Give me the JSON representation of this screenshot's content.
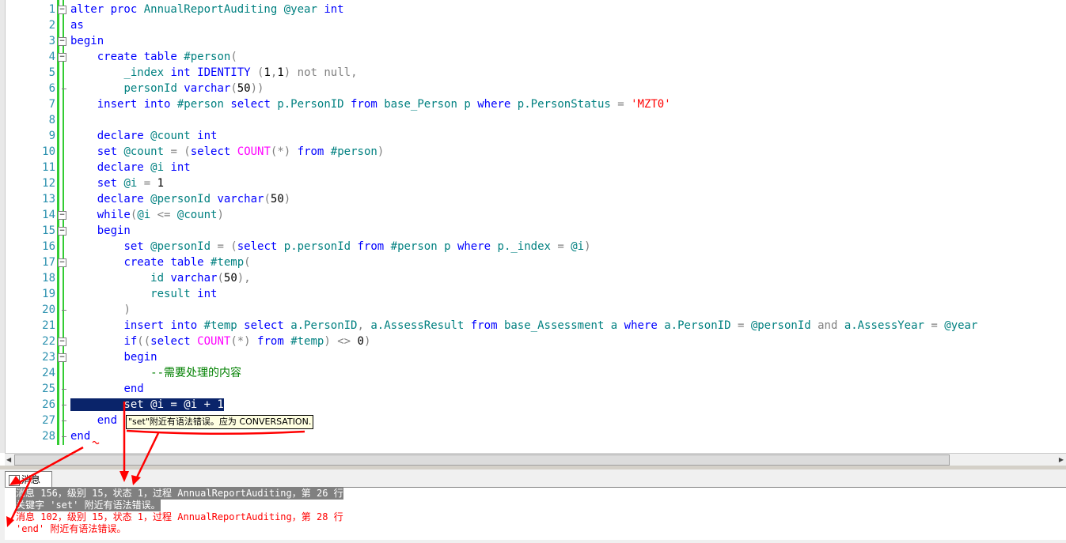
{
  "editor": {
    "lines": [
      {
        "n": "1",
        "tokens": [
          [
            "k",
            "alter proc "
          ],
          [
            "t",
            "AnnualReportAuditing "
          ],
          [
            "t",
            "@year "
          ],
          [
            "k",
            "int"
          ]
        ]
      },
      {
        "n": "2",
        "tokens": [
          [
            "k",
            "as"
          ]
        ]
      },
      {
        "n": "3",
        "tokens": [
          [
            "k",
            "begin"
          ]
        ]
      },
      {
        "n": "4",
        "tokens": [
          [
            "",
            "    "
          ],
          [
            "k",
            "create table "
          ],
          [
            "t",
            "#person"
          ],
          [
            "g",
            "("
          ]
        ]
      },
      {
        "n": "5",
        "tokens": [
          [
            "",
            "        "
          ],
          [
            "t",
            "_index "
          ],
          [
            "k",
            "int IDENTITY "
          ],
          [
            "g",
            "("
          ],
          [
            "",
            "1"
          ],
          [
            "g",
            ","
          ],
          [
            "",
            "1"
          ],
          [
            "g",
            ") not null,"
          ]
        ]
      },
      {
        "n": "6",
        "tokens": [
          [
            "",
            "        "
          ],
          [
            "t",
            "personId "
          ],
          [
            "k",
            "varchar"
          ],
          [
            "g",
            "("
          ],
          [
            "",
            "50"
          ],
          [
            "g",
            "))"
          ]
        ]
      },
      {
        "n": "7",
        "tokens": [
          [
            "",
            "    "
          ],
          [
            "k",
            "insert into "
          ],
          [
            "t",
            "#person "
          ],
          [
            "k",
            "select "
          ],
          [
            "t",
            "p.PersonID "
          ],
          [
            "k",
            "from "
          ],
          [
            "t",
            "base_Person p "
          ],
          [
            "k",
            "where "
          ],
          [
            "t",
            "p.PersonStatus "
          ],
          [
            "g",
            "= "
          ],
          [
            "s",
            "'MZT0'"
          ]
        ]
      },
      {
        "n": "8",
        "tokens": []
      },
      {
        "n": "9",
        "tokens": [
          [
            "",
            "    "
          ],
          [
            "k",
            "declare "
          ],
          [
            "t",
            "@count "
          ],
          [
            "k",
            "int"
          ]
        ]
      },
      {
        "n": "10",
        "tokens": [
          [
            "",
            "    "
          ],
          [
            "k",
            "set "
          ],
          [
            "t",
            "@count "
          ],
          [
            "g",
            "= ("
          ],
          [
            "k",
            "select "
          ],
          [
            "f",
            "COUNT"
          ],
          [
            "g",
            "(*) "
          ],
          [
            "k",
            "from "
          ],
          [
            "t",
            "#person"
          ],
          [
            "g",
            ")"
          ]
        ]
      },
      {
        "n": "11",
        "tokens": [
          [
            "",
            "    "
          ],
          [
            "k",
            "declare "
          ],
          [
            "t",
            "@i "
          ],
          [
            "k",
            "int"
          ]
        ]
      },
      {
        "n": "12",
        "tokens": [
          [
            "",
            "    "
          ],
          [
            "k",
            "set "
          ],
          [
            "t",
            "@i "
          ],
          [
            "g",
            "= "
          ],
          [
            "",
            "1"
          ]
        ]
      },
      {
        "n": "13",
        "tokens": [
          [
            "",
            "    "
          ],
          [
            "k",
            "declare "
          ],
          [
            "t",
            "@personId "
          ],
          [
            "k",
            "varchar"
          ],
          [
            "g",
            "("
          ],
          [
            "",
            "50"
          ],
          [
            "g",
            ")"
          ]
        ]
      },
      {
        "n": "14",
        "tokens": [
          [
            "",
            "    "
          ],
          [
            "k",
            "while"
          ],
          [
            "g",
            "("
          ],
          [
            "t",
            "@i "
          ],
          [
            "g",
            "<= "
          ],
          [
            "t",
            "@count"
          ],
          [
            "g",
            ")"
          ]
        ]
      },
      {
        "n": "15",
        "tokens": [
          [
            "",
            "    "
          ],
          [
            "k",
            "begin"
          ]
        ]
      },
      {
        "n": "16",
        "tokens": [
          [
            "",
            "        "
          ],
          [
            "k",
            "set "
          ],
          [
            "t",
            "@personId "
          ],
          [
            "g",
            "= ("
          ],
          [
            "k",
            "select "
          ],
          [
            "t",
            "p.personId "
          ],
          [
            "k",
            "from "
          ],
          [
            "t",
            "#person p "
          ],
          [
            "k",
            "where "
          ],
          [
            "t",
            "p._index "
          ],
          [
            "g",
            "= "
          ],
          [
            "t",
            "@i"
          ],
          [
            "g",
            ")"
          ]
        ]
      },
      {
        "n": "17",
        "tokens": [
          [
            "",
            "        "
          ],
          [
            "k",
            "create table "
          ],
          [
            "t",
            "#temp"
          ],
          [
            "g",
            "("
          ]
        ]
      },
      {
        "n": "18",
        "tokens": [
          [
            "",
            "            "
          ],
          [
            "t",
            "id "
          ],
          [
            "k",
            "varchar"
          ],
          [
            "g",
            "("
          ],
          [
            "",
            "50"
          ],
          [
            "g",
            "),"
          ]
        ]
      },
      {
        "n": "19",
        "tokens": [
          [
            "",
            "            "
          ],
          [
            "t",
            "result "
          ],
          [
            "k",
            "int"
          ]
        ]
      },
      {
        "n": "20",
        "tokens": [
          [
            "",
            "        "
          ],
          [
            "g",
            ")"
          ]
        ]
      },
      {
        "n": "21",
        "tokens": [
          [
            "",
            "        "
          ],
          [
            "k",
            "insert into "
          ],
          [
            "t",
            "#temp "
          ],
          [
            "k",
            "select "
          ],
          [
            "t",
            "a.PersonID"
          ],
          [
            "g",
            ", "
          ],
          [
            "t",
            "a.AssessResult "
          ],
          [
            "k",
            "from "
          ],
          [
            "t",
            "base_Assessment a "
          ],
          [
            "k",
            "where "
          ],
          [
            "t",
            "a.PersonID "
          ],
          [
            "g",
            "= "
          ],
          [
            "t",
            "@personId "
          ],
          [
            "g",
            "and "
          ],
          [
            "t",
            "a.AssessYear "
          ],
          [
            "g",
            "= "
          ],
          [
            "t",
            "@year"
          ]
        ]
      },
      {
        "n": "22",
        "tokens": [
          [
            "",
            "        "
          ],
          [
            "k",
            "if"
          ],
          [
            "g",
            "(("
          ],
          [
            "k",
            "select "
          ],
          [
            "f",
            "COUNT"
          ],
          [
            "g",
            "(*) "
          ],
          [
            "k",
            "from "
          ],
          [
            "t",
            "#temp"
          ],
          [
            "g",
            ") <> "
          ],
          [
            "",
            "0"
          ],
          [
            "g",
            ")"
          ]
        ]
      },
      {
        "n": "23",
        "tokens": [
          [
            "",
            "        "
          ],
          [
            "k",
            "begin"
          ]
        ]
      },
      {
        "n": "24",
        "tokens": [
          [
            "",
            "            "
          ],
          [
            "c",
            "--需要处理的内容"
          ]
        ]
      },
      {
        "n": "25",
        "tokens": [
          [
            "",
            "        "
          ],
          [
            "k",
            "end"
          ]
        ]
      },
      {
        "n": "26",
        "tokens": [
          [
            "sel",
            "        set @i = @i + 1"
          ]
        ]
      },
      {
        "n": "27",
        "tokens": [
          [
            "",
            "    "
          ],
          [
            "k",
            "end"
          ]
        ]
      },
      {
        "n": "28",
        "tokens": [
          [
            "k",
            "end"
          ]
        ]
      }
    ],
    "tooltip": "\"set\"附近有语法错误。应为 CONVERSATION."
  },
  "results": {
    "tab_label": "消息",
    "messages": [
      "消息 156，级别 15，状态 1，过程 AnnualReportAuditing，第 26 行",
      "关键字 'set' 附近有语法错误。",
      "消息 102，级别 15，状态 1，过程 AnnualReportAuditing，第 28 行",
      "'end' 附近有语法错误。"
    ]
  },
  "colors": {
    "keyword": "#0000ff",
    "string": "#ff0000",
    "comment": "#008000",
    "selection": "#0a246a",
    "annotation": "#ff0000"
  }
}
